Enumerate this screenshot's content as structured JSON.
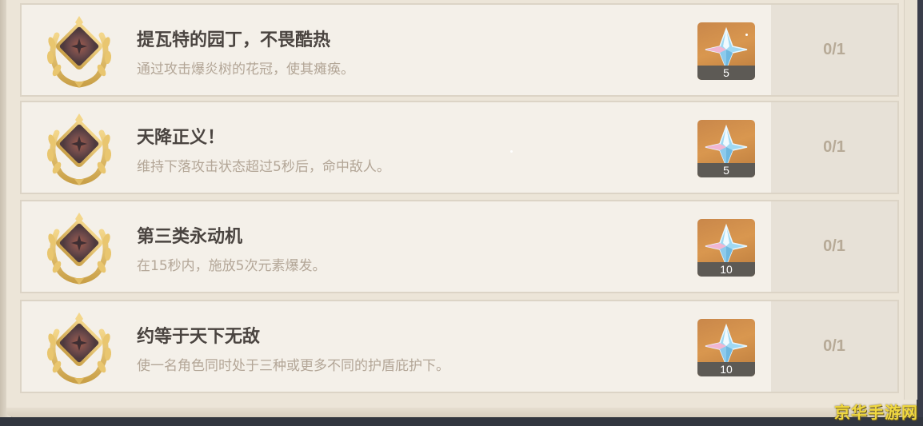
{
  "achievements": [
    {
      "title": "提瓦特的园丁，不畏酷热",
      "desc": "通过攻击爆炎树的花冠，使其瘫痪。",
      "reward_count": "5",
      "progress": "0/1"
    },
    {
      "title": "天降正义！",
      "desc": "维持下落攻击状态超过5秒后，命中敌人。",
      "reward_count": "5",
      "progress": "0/1"
    },
    {
      "title": "第三类永动机",
      "desc": "在15秒内，施放5次元素爆发。",
      "reward_count": "10",
      "progress": "0/1"
    },
    {
      "title": "约等于天下无敌",
      "desc": "使一名角色同时处于三种或更多不同的护盾庇护下。",
      "reward_count": "10",
      "progress": "0/1"
    }
  ],
  "reward_icon": "primogem-icon",
  "badge_icon": "achievement-laurel-badge-icon",
  "watermark": "京华手游网",
  "colors": {
    "panel_bg": "#ece5d8",
    "row_bg": "#f4f0e9",
    "reward_bg": "#c9874a",
    "title": "#4a4440",
    "desc": "#b3a697"
  }
}
